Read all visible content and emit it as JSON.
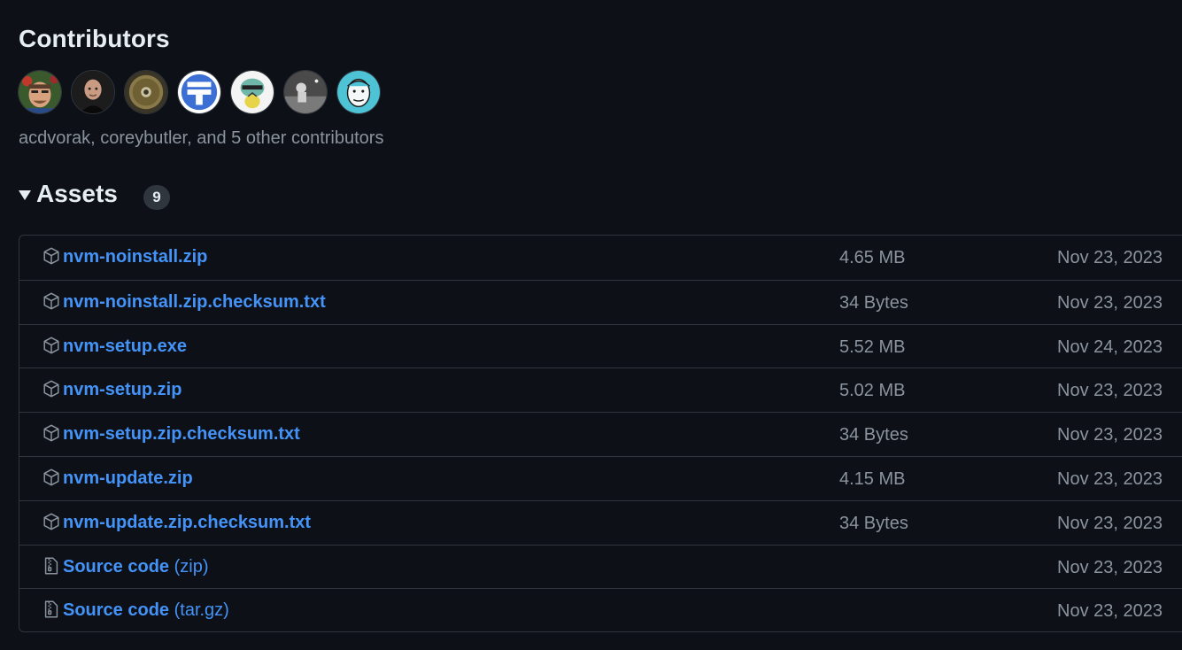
{
  "contributors": {
    "title": "Contributors",
    "summary": "acdvorak, coreybutler, and 5 other contributors",
    "avatars": [
      {
        "name": "acdvorak"
      },
      {
        "name": "coreybutler"
      },
      {
        "name": "contributor-3"
      },
      {
        "name": "contributor-4"
      },
      {
        "name": "contributor-5"
      },
      {
        "name": "contributor-6"
      },
      {
        "name": "contributor-7"
      }
    ]
  },
  "assets": {
    "title": "Assets",
    "count": "9",
    "items": [
      {
        "name": "nvm-noinstall.zip",
        "suffix": "",
        "size": "4.65 MB",
        "date": "Nov 23, 2023",
        "icon": "package-icon"
      },
      {
        "name": "nvm-noinstall.zip.checksum.txt",
        "suffix": "",
        "size": "34 Bytes",
        "date": "Nov 23, 2023",
        "icon": "package-icon"
      },
      {
        "name": "nvm-setup.exe",
        "suffix": "",
        "size": "5.52 MB",
        "date": "Nov 24, 2023",
        "icon": "package-icon"
      },
      {
        "name": "nvm-setup.zip",
        "suffix": "",
        "size": "5.02 MB",
        "date": "Nov 23, 2023",
        "icon": "package-icon"
      },
      {
        "name": "nvm-setup.zip.checksum.txt",
        "suffix": "",
        "size": "34 Bytes",
        "date": "Nov 23, 2023",
        "icon": "package-icon"
      },
      {
        "name": "nvm-update.zip",
        "suffix": "",
        "size": "4.15 MB",
        "date": "Nov 23, 2023",
        "icon": "package-icon"
      },
      {
        "name": "nvm-update.zip.checksum.txt",
        "suffix": "",
        "size": "34 Bytes",
        "date": "Nov 23, 2023",
        "icon": "package-icon"
      },
      {
        "name": "Source code",
        "suffix": " (zip)",
        "size": "",
        "date": "Nov 23, 2023",
        "icon": "file-zip-icon"
      },
      {
        "name": "Source code",
        "suffix": " (tar.gz)",
        "size": "",
        "date": "Nov 23, 2023",
        "icon": "file-zip-icon"
      }
    ]
  },
  "colors": {
    "background": "#0d1117",
    "link": "#4493f8",
    "muted": "#8b949e",
    "border": "#30363d"
  }
}
